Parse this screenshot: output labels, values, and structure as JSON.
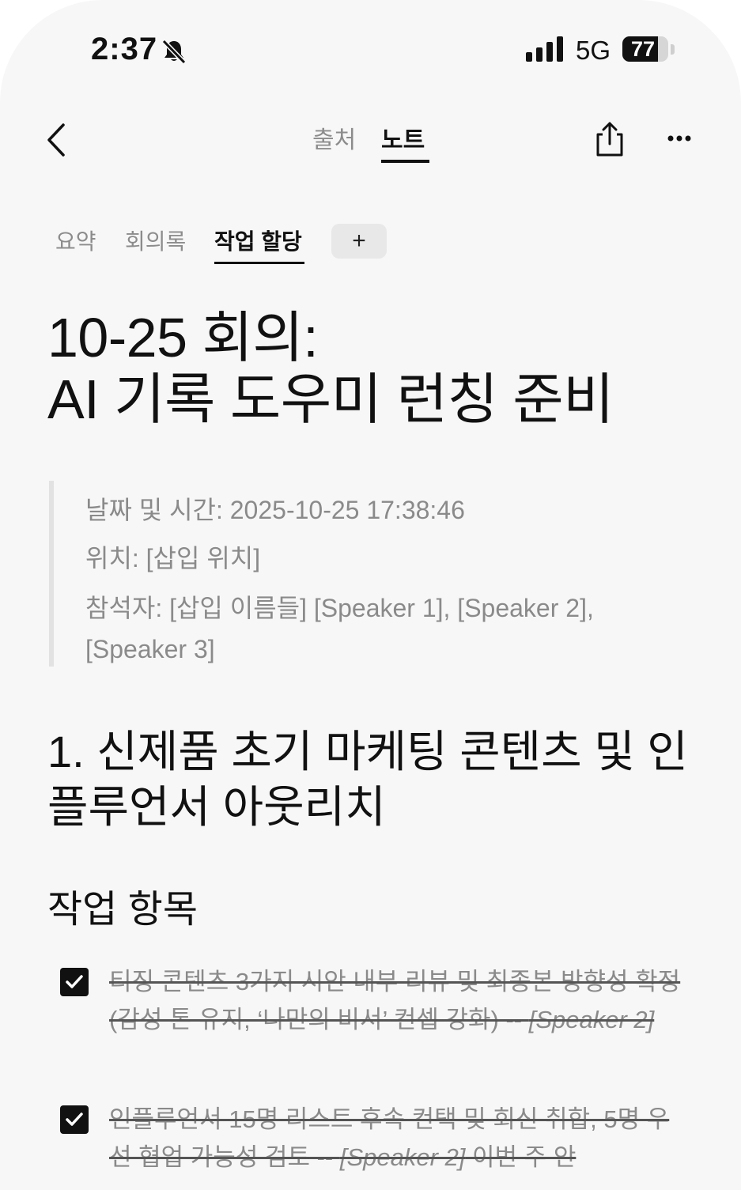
{
  "status_bar": {
    "time": "2:37",
    "network": "5G",
    "battery": "77",
    "battery_level": 0.77
  },
  "nav": {
    "tab_source": "출처",
    "tab_note": "노트",
    "icons": [
      "back-chevron-icon",
      "share-icon",
      "more-icon"
    ]
  },
  "sub_tabs": [
    {
      "label": "요약"
    },
    {
      "label": "회의록"
    },
    {
      "label": "작업 할당"
    },
    {
      "label": "+"
    }
  ],
  "note": {
    "title_line1": "10-25 회의:",
    "title_line2": "AI 기록 도우미 런칭 준비",
    "meta": {
      "datetime": "날짜 및 시간: 2025-10-25 17:38:46",
      "location": "위치: [삽입 위치]",
      "attendees": "참석자: [삽입 이름들] [Speaker 1], [Speaker 2], [Speaker 3]"
    },
    "section_heading": "1. 신제품 초기 마케팅 콘텐츠 및 인플루언서 아웃리치",
    "subheading": "작업 항목",
    "tasks": [
      {
        "text": "티징 콘텐츠 3가지 시안 내부 리뷰 및 최종본 방향성 확정(감성 톤 유지, ‘나만의 비서’ 컨셉 강화) -- ",
        "speaker": "[Speaker 2]",
        "after": "",
        "checked": true
      },
      {
        "text": "인플루언서 15명 리스트 후속 컨택 및 회신 취합, 5명 우선 협업 가능성 검토 -- ",
        "speaker": "[Speaker 2]",
        "after": " 이번 주 안",
        "checked": true
      }
    ]
  },
  "colors": {
    "background": "#f7f7f7",
    "text_primary": "#111111",
    "text_muted": "#8a8a8a",
    "accent_chip": "#e8e8e8"
  }
}
